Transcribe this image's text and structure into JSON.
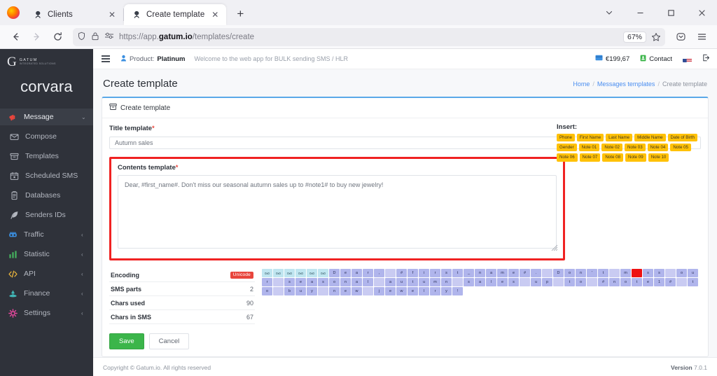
{
  "browser": {
    "tabs": [
      {
        "title": "Clients",
        "favicon": "gatum-icon",
        "active": false
      },
      {
        "title": "Create template",
        "favicon": "gatum-icon",
        "active": true
      }
    ],
    "new_tab_label": "+",
    "tab_list_label": "∨",
    "window_controls": {
      "minimize": "—",
      "maximize": "❐",
      "close": "✕"
    },
    "nav": {
      "back": "←",
      "forward": "→",
      "reload": "⟳"
    },
    "url_prefix": "https://app.",
    "url_domain": "gatum.io",
    "url_path": "/templates/create",
    "zoom_level": "67%",
    "icons": {
      "shield": "shield-icon",
      "lock": "lock-icon",
      "tracker": "tracker-protection-icon",
      "bookmark": "star-icon",
      "pocket": "pocket-icon",
      "menu": "hamburger-menu-icon"
    }
  },
  "sidebar": {
    "logo_letter": "G",
    "logo_line1": "GATUM",
    "logo_line2": "INTEGRATED SOLUTIONS",
    "brand": "corvara",
    "items": [
      {
        "label": "Message",
        "icon": "megaphone-icon",
        "color": "#e8453c",
        "chevron": "⌄",
        "active": true,
        "sub": false
      },
      {
        "label": "Compose",
        "icon": "envelope-icon",
        "color": "#b3b7c0",
        "chevron": "",
        "active": false,
        "sub": true
      },
      {
        "label": "Templates",
        "icon": "archive-icon",
        "color": "#b3b7c0",
        "chevron": "",
        "active": false,
        "sub": true
      },
      {
        "label": "Scheduled SMS",
        "icon": "calendar-icon",
        "color": "#b3b7c0",
        "chevron": "",
        "active": false,
        "sub": true
      },
      {
        "label": "Databases",
        "icon": "database-icon",
        "color": "#b3b7c0",
        "chevron": "",
        "active": false,
        "sub": true
      },
      {
        "label": "Senders IDs",
        "icon": "feather-icon",
        "color": "#b3b7c0",
        "chevron": "",
        "active": false,
        "sub": true
      },
      {
        "label": "Traffic",
        "icon": "traffic-icon",
        "color": "#3b8fe0",
        "chevron": "‹",
        "active": false,
        "sub": false
      },
      {
        "label": "Statistic",
        "icon": "chart-icon",
        "color": "#46b35e",
        "chevron": "‹",
        "active": false,
        "sub": false
      },
      {
        "label": "API",
        "icon": "code-icon",
        "color": "#e8b33c",
        "chevron": "‹",
        "active": false,
        "sub": false
      },
      {
        "label": "Finance",
        "icon": "coins-icon",
        "color": "#41b6b6",
        "chevron": "‹",
        "active": false,
        "sub": false
      },
      {
        "label": "Settings",
        "icon": "gear-icon",
        "color": "#e3479c",
        "chevron": "‹",
        "active": false,
        "sub": false
      }
    ]
  },
  "topbar": {
    "menu_toggle": "hamburger-menu-icon",
    "product_label": "Product:",
    "product_value": "Platinum",
    "welcome": "Welcome to the web app for BULK sending SMS / HLR",
    "balance": "€199,67",
    "contact": "Contact",
    "flag": "us-flag-icon",
    "logout": "logout-icon"
  },
  "page": {
    "title": "Create template",
    "breadcrumb": [
      {
        "label": "Home",
        "link": true
      },
      {
        "label": "Messages templates",
        "link": true
      },
      {
        "label": "Create template",
        "link": false
      }
    ]
  },
  "card": {
    "header_icon": "archive-icon",
    "header_title": "Create template",
    "title_field": {
      "label": "Title template",
      "required": "*",
      "value": "Autumn sales",
      "placeholder": "Title template"
    },
    "contents_field": {
      "label": "Contents template",
      "required": "*",
      "value": "Dear, #first_name#. Don't miss our seasonal autumn sales up to #note1# to buy new jewelry!",
      "placeholder": "Contents template"
    },
    "insert": {
      "title": "Insert:",
      "tags": [
        "Phone",
        "First Name",
        "Last Name",
        "Middle Name",
        "Date of Birth",
        "Gender",
        "Note 01",
        "Note 02",
        "Note 03",
        "Note 04",
        "Note 05",
        "Note 06",
        "Note 07",
        "Note 08",
        "Note 09",
        "Note 10"
      ]
    },
    "stats": [
      {
        "key": "Encoding",
        "value": "Unicode",
        "badge": true
      },
      {
        "key": "SMS parts",
        "value": "2",
        "badge": false
      },
      {
        "key": "Chars used",
        "value": "90",
        "badge": false
      },
      {
        "key": "Chars in SMS",
        "value": "67",
        "badge": false
      }
    ],
    "char_viz": {
      "null_label": "0x0",
      "leading_nulls": 6,
      "text": "Dear, #first_name#. Don't miss our seasonal autumn sales up to #note1# to buy new jewelry!",
      "invalid_char_index": 27
    },
    "buttons": {
      "save": "Save",
      "cancel": "Cancel"
    }
  },
  "footer": {
    "copyright": "Copyright © Gatum.io. All rights reserved",
    "version_label": "Version",
    "version_value": "7.0.1"
  },
  "colors": {
    "accent_blue": "#5aa9e8",
    "highlight_red": "#f02222",
    "tag_yellow": "#ffc107",
    "save_green": "#3bb54a",
    "sidebar_bg": "#2f323a"
  }
}
